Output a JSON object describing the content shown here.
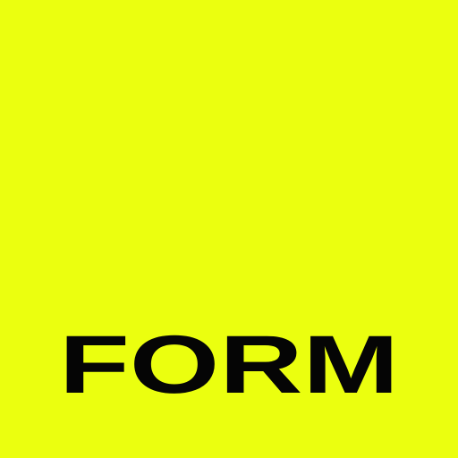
{
  "brand": {
    "wordmark": "FORM",
    "background_color": "#ebff0f",
    "text_color": "#050505"
  }
}
